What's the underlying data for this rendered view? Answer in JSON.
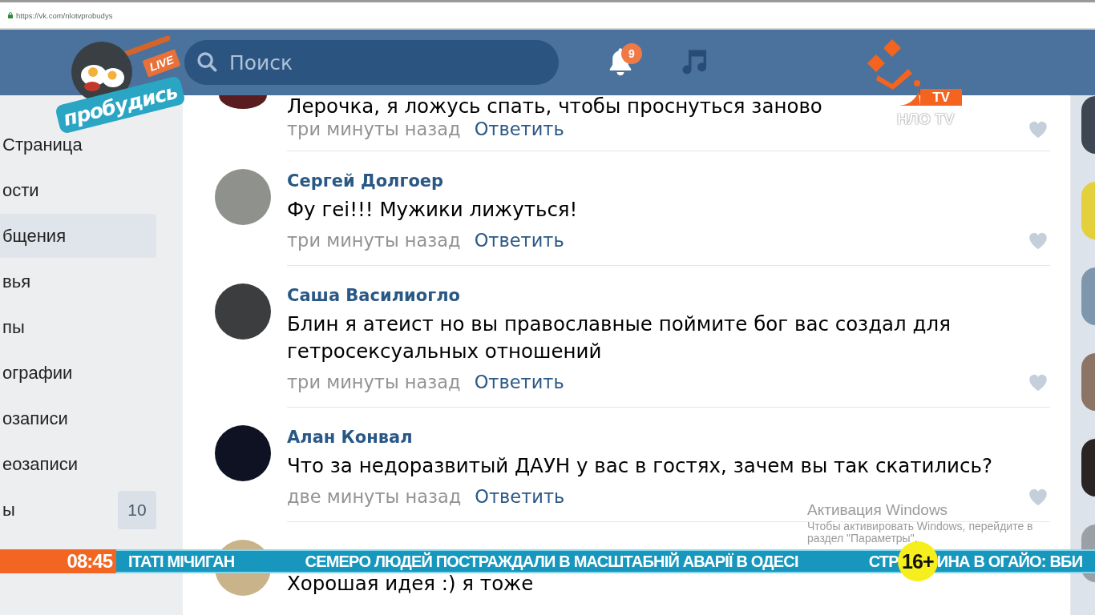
{
  "browser": {
    "url": "https://vk.com/nlotvprobudys"
  },
  "header": {
    "search": {
      "placeholder": "Поиск"
    },
    "notifications": {
      "count": "9"
    }
  },
  "sidebar": {
    "items": [
      {
        "label": "Страница",
        "selected": false
      },
      {
        "label": "ости",
        "selected": false
      },
      {
        "label": "бщения",
        "selected": true
      },
      {
        "label": "вья",
        "selected": false
      },
      {
        "label": "пы",
        "selected": false
      },
      {
        "label": "ографии",
        "selected": false
      },
      {
        "label": "озаписи",
        "selected": false
      },
      {
        "label": "еозаписи",
        "selected": false
      },
      {
        "label": "ы",
        "selected": false,
        "count": "10"
      }
    ]
  },
  "comments": [
    {
      "text": "Лерочка, я ложусь спать, чтобы проснуться заново",
      "time": "три минуты назад",
      "reply": "Ответить"
    },
    {
      "author": "Сергей Долгоер",
      "text": "Фу геі!!! Мужики лижуться!",
      "time": "три минуты назад",
      "reply": "Ответить"
    },
    {
      "author": "Саша Василиогло",
      "text": "Блин я атеист но вы православные поймите бог вас создал для гетросексуальных отношений",
      "time": "три минуты назад",
      "reply": "Ответить"
    },
    {
      "author": "Алан Конвал",
      "text": "Что за недоразвитый ДАУН у вас в гостях, зачем вы так скатились?",
      "time": "две минуты назад",
      "reply": "Ответить"
    },
    {
      "text": "Хорошая идея :) я тоже"
    }
  ],
  "broadcast": {
    "show_logo": {
      "badge": "LIVE",
      "title": "пробудись"
    },
    "channel_logo": {
      "badge": "TV",
      "name": "НЛО TV"
    },
    "ticker": {
      "time": "08:45",
      "items": [
        {
          "kind": "headline",
          "text": "ІТАТІ МІЧИГАН"
        },
        {
          "kind": "headline",
          "text": "СЕМЕРО ЛЮДЕЙ ПОСТРАЖДАЛИ В МАСШТАБНІЙ АВАРІЇ В ОДЕСІ"
        },
        {
          "kind": "headline",
          "text": "СТР"
        },
        {
          "kind": "age_rating",
          "text": "16+"
        },
        {
          "kind": "headline",
          "text": "ИНА В ОГАЙО: ВБИ"
        }
      ]
    }
  },
  "os_notice": {
    "title": "Активация Windows",
    "text": "Чтобы активировать Windows, перейдите в раздел \"Параметры\"."
  }
}
